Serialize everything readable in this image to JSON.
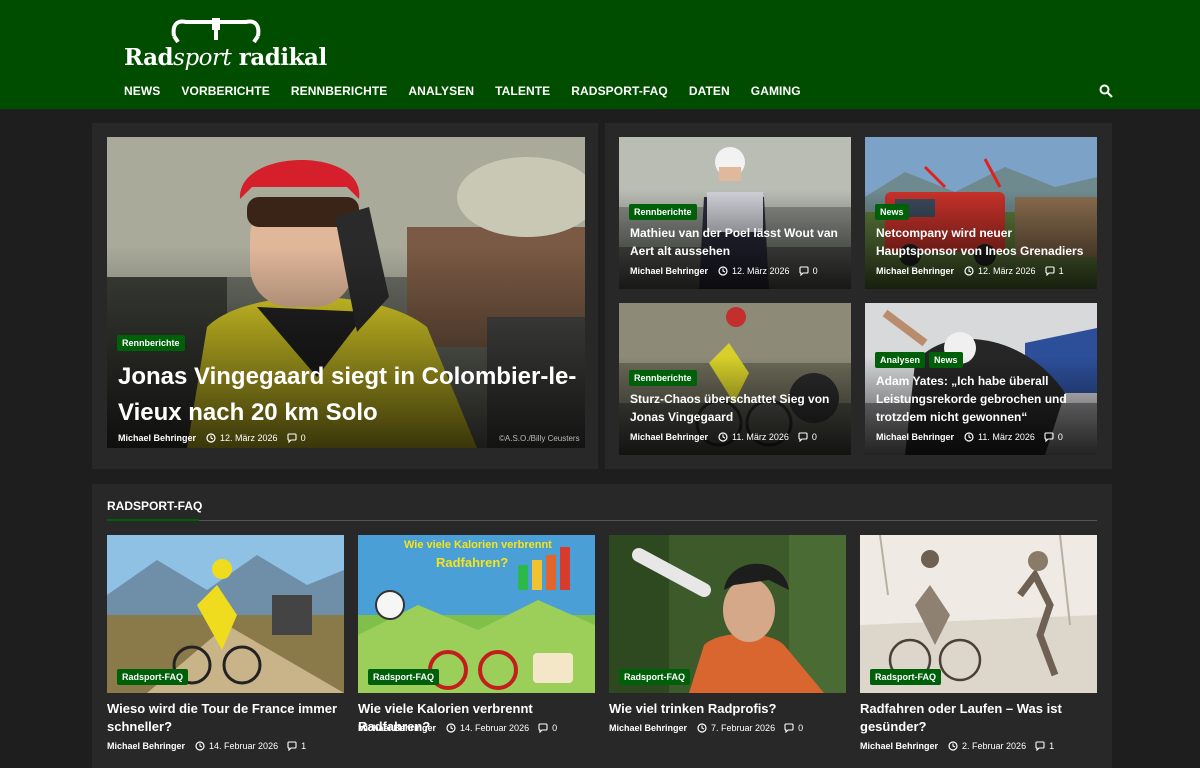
{
  "site": {
    "logo_text": "Radsport radikal",
    "logo_part1": "Rad",
    "logo_part2": "sport",
    "logo_part3": " radikal"
  },
  "nav": {
    "items": [
      "NEWS",
      "VORBERICHTE",
      "RENNBERICHTE",
      "ANALYSEN",
      "TALENTE",
      "RADSPORT-FAQ",
      "DATEN",
      "GAMING"
    ]
  },
  "hero": {
    "badge": "Rennberichte",
    "title": "Jonas Vingegaard siegt in Colombier-le-Vieux nach 20 km Solo",
    "author": "Michael Behringer",
    "date": "12. März 2026",
    "comments": "0",
    "credit": "©A.S.O./Billy Ceusters"
  },
  "grid": [
    {
      "badges": [
        "Rennberichte"
      ],
      "title": "Mathieu van der Poel lässt Wout van Aert alt aussehen",
      "author": "Michael Behringer",
      "date": "12. März 2026",
      "comments": "0"
    },
    {
      "badges": [
        "News"
      ],
      "title": "Netcompany wird neuer Hauptsponsor von Ineos Grenadiers",
      "author": "Michael Behringer",
      "date": "12. März 2026",
      "comments": "1"
    },
    {
      "badges": [
        "Rennberichte"
      ],
      "title": "Sturz-Chaos überschattet Sieg von Jonas Vingegaard",
      "author": "Michael Behringer",
      "date": "11. März 2026",
      "comments": "0"
    },
    {
      "badges": [
        "Analysen",
        "News"
      ],
      "title": "Adam Yates: „Ich habe überall Leistungsrekorde gebrochen und trotzdem nicht gewonnen“",
      "author": "Michael Behringer",
      "date": "11. März 2026",
      "comments": "0"
    }
  ],
  "faq": {
    "heading": "RADSPORT-FAQ",
    "items": [
      {
        "badge": "Radsport-FAQ",
        "title": "Wieso wird die Tour de France immer schneller?",
        "author": "Michael Behringer",
        "date": "14. Februar 2026",
        "comments": "1"
      },
      {
        "badge": "Radsport-FAQ",
        "title": "Wie viele Kalorien verbrennt Radfahren?",
        "author": "Michael Behringer",
        "date": "14. Februar 2026",
        "comments": "0",
        "image_text_1": "Wie viele Kalorien verbrennt",
        "image_text_2": "Radfahren?"
      },
      {
        "badge": "Radsport-FAQ",
        "title": "Wie viel trinken Radprofis?",
        "author": "Michael Behringer",
        "date": "7. Februar 2026",
        "comments": "0"
      },
      {
        "badge": "Radsport-FAQ",
        "title": "Radfahren oder Laufen – Was ist gesünder?",
        "author": "Michael Behringer",
        "date": "2. Februar 2026",
        "comments": "1"
      }
    ]
  },
  "colors": {
    "header_bg": "#004d00",
    "badge_bg": "#00600a",
    "page_bg": "#1e1e1e",
    "panel_bg": "#282828"
  }
}
